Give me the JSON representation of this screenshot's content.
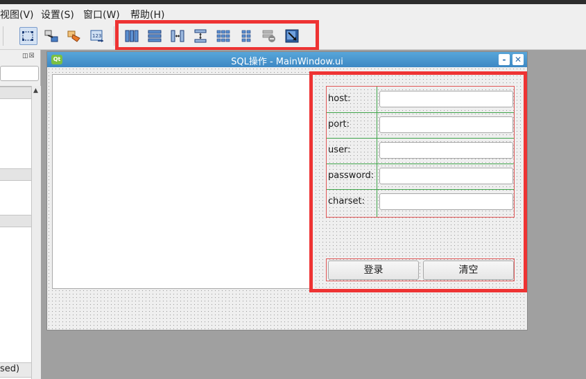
{
  "menubar": {
    "items": [
      {
        "label": "视图(V)"
      },
      {
        "label": "设置(S)"
      },
      {
        "label": "窗口(W)"
      },
      {
        "label": "帮助(H)"
      }
    ]
  },
  "toolbar": {
    "left_icons": [
      "edit-widgets-icon",
      "edit-signals-slots-icon",
      "edit-buddies-icon",
      "edit-tab-order-icon"
    ],
    "layout_icons": [
      "layout-horizontal-icon",
      "layout-vertical-icon",
      "layout-horizontal-splitter-icon",
      "layout-vertical-splitter-icon",
      "layout-grid-icon",
      "layout-form-icon",
      "break-layout-icon",
      "adjust-size-icon"
    ],
    "highlight_color": "#ee3333"
  },
  "left_panel": {
    "partial_text": "sed)"
  },
  "form_window": {
    "title": "SQL操作 - MainWindow.ui",
    "icon_text": "Qt",
    "minimize_label": "-",
    "close_label": "✕",
    "titlebar_color": "#3d88c4",
    "fields": [
      {
        "label": "host:",
        "value": ""
      },
      {
        "label": "port:",
        "value": ""
      },
      {
        "label": "user:",
        "value": ""
      },
      {
        "label": "password:",
        "value": ""
      },
      {
        "label": "charset:",
        "value": ""
      }
    ],
    "buttons": {
      "login": "登录",
      "clear": "清空"
    }
  }
}
